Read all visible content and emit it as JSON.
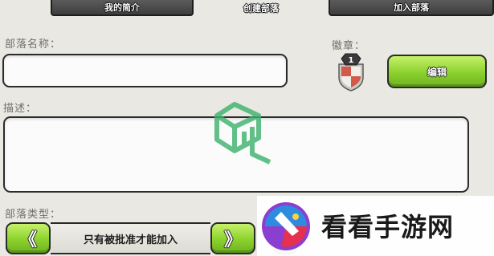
{
  "tabs": [
    {
      "label": "我的简介",
      "active": false
    },
    {
      "label": "创建部落",
      "active": true
    },
    {
      "label": "加入部落",
      "active": false
    }
  ],
  "form": {
    "clan_name_label": "部落名称：",
    "clan_name_value": "",
    "badge_label": "徽章：",
    "badge_level": "1",
    "edit_label": "编辑",
    "description_label": "描述：",
    "description_value": "",
    "clan_type_label": "部落类型：",
    "clan_type_value": "只有被批准才能加入",
    "prev_label": "《",
    "next_label": "》"
  },
  "watermark": {
    "site_text": "看看手游网"
  },
  "colors": {
    "background": "#e9e8e2",
    "button_green": "#8bd12d",
    "tab_dark": "#4a4a4a",
    "watermark_green": "#3bb26b"
  }
}
